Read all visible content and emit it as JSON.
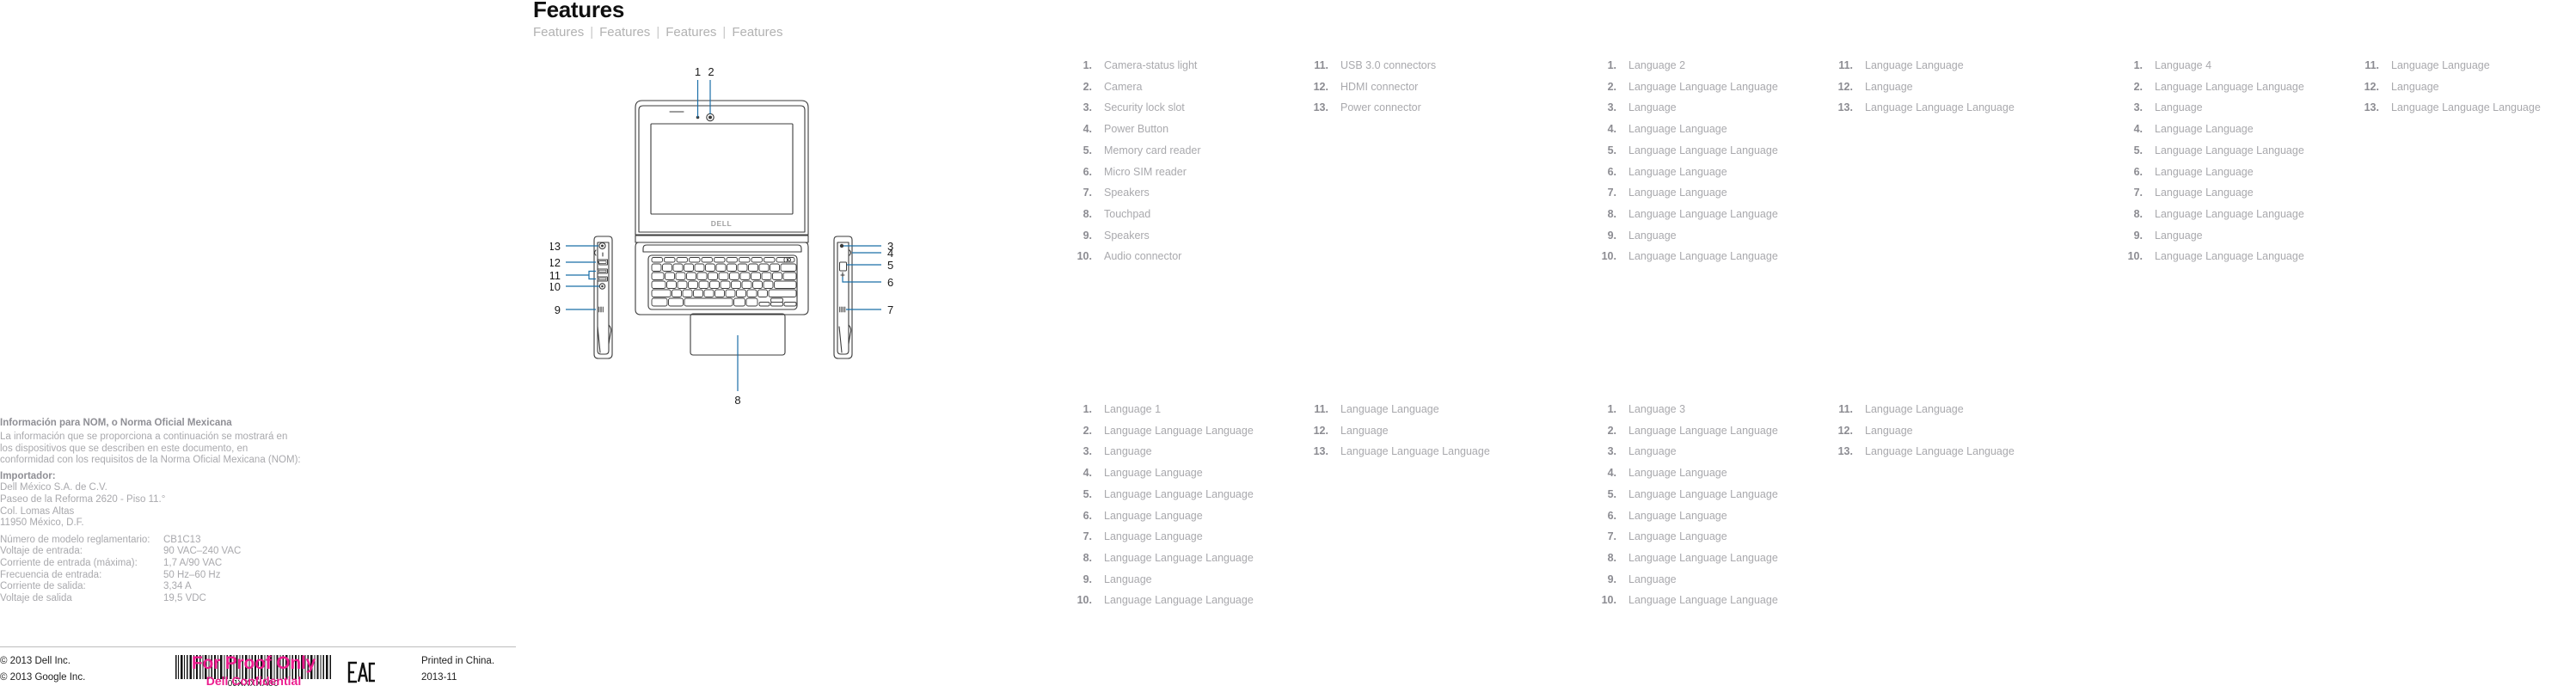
{
  "header": {
    "title": "Features",
    "subtitle_items": [
      "Features",
      "Features",
      "Features",
      "Features"
    ],
    "separator": "|"
  },
  "nom": {
    "heading": "Información para NOM, o Norma Oficial Mexicana",
    "intro": "La información que se proporciona a continuación se mostrará en los dispositivos que se describen en este documento, en conformidad con los requisitos de la Norma Oficial Mexicana (NOM):",
    "importer_label": "Importador:",
    "address": [
      "Dell México S.A. de C.V.",
      "Paseo de la Reforma 2620 - Piso 11.°",
      "Col. Lomas Altas",
      "11950 México, D.F."
    ],
    "specs": [
      {
        "label": "Número de modelo reglamentario:",
        "value": "CB1C13"
      },
      {
        "label": "Voltaje de entrada:",
        "value": "90 VAC–240 VAC"
      },
      {
        "label": "Corriente de entrada (máxima):",
        "value": "1,7 A/90 VAC"
      },
      {
        "label": "Frecuencia de entrada:",
        "value": "50 Hz–60 Hz"
      },
      {
        "label": "Corriente de salida:",
        "value": "3,34 A"
      },
      {
        "label": "Voltaje de salida",
        "value": "19,5 VDC"
      }
    ]
  },
  "footer": {
    "copyright_lines": [
      "© 2013 Dell Inc.",
      "© 2013 Google Inc."
    ],
    "barcode_number": "0JXXXXA00",
    "proof_line1": "For Proof Only",
    "proof_line2": "Dell Confidential",
    "eac_label": "EAC",
    "print_lines": [
      "Printed in China.",
      "2013-11"
    ]
  },
  "diagram": {
    "brand_logo": "DELL",
    "callouts": [
      {
        "id": "1",
        "label": "1"
      },
      {
        "id": "2",
        "label": "2"
      },
      {
        "id": "3",
        "label": "3"
      },
      {
        "id": "4",
        "label": "4"
      },
      {
        "id": "5",
        "label": "5"
      },
      {
        "id": "6",
        "label": "6"
      },
      {
        "id": "7",
        "label": "7"
      },
      {
        "id": "8",
        "label": "8"
      },
      {
        "id": "9",
        "label": "9"
      },
      {
        "id": "10",
        "label": "10"
      },
      {
        "id": "11",
        "label": "11"
      },
      {
        "id": "12",
        "label": "12"
      },
      {
        "id": "13",
        "label": "13"
      }
    ]
  },
  "feature_blocks": [
    {
      "id": "english-top",
      "col_a": [
        {
          "num": "1.",
          "text": "Camera-status light"
        },
        {
          "num": "2.",
          "text": "Camera"
        },
        {
          "num": "3.",
          "text": "Security lock slot"
        },
        {
          "num": "4.",
          "text": "Power Button"
        },
        {
          "num": "5.",
          "text": "Memory card reader"
        },
        {
          "num": "6.",
          "text": "Micro SIM reader"
        },
        {
          "num": "7.",
          "text": "Speakers"
        },
        {
          "num": "8.",
          "text": "Touchpad"
        },
        {
          "num": "9.",
          "text": "Speakers"
        },
        {
          "num": "10.",
          "text": "Audio connector"
        }
      ],
      "col_b": [
        {
          "num": "11.",
          "text": "USB 3.0 connectors"
        },
        {
          "num": "12.",
          "text": "HDMI connector"
        },
        {
          "num": "13.",
          "text": "Power connector"
        }
      ]
    },
    {
      "id": "language-2-top",
      "col_a": [
        {
          "num": "1.",
          "text": "Language 2"
        },
        {
          "num": "2.",
          "text": "Language Language Language"
        },
        {
          "num": "3.",
          "text": "Language"
        },
        {
          "num": "4.",
          "text": "Language Language"
        },
        {
          "num": "5.",
          "text": "Language Language Language"
        },
        {
          "num": "6.",
          "text": "Language Language"
        },
        {
          "num": "7.",
          "text": "Language Language"
        },
        {
          "num": "8.",
          "text": "Language Language Language"
        },
        {
          "num": "9.",
          "text": "Language"
        },
        {
          "num": "10.",
          "text": "Language Language Language"
        }
      ],
      "col_b": [
        {
          "num": "11.",
          "text": "Language Language"
        },
        {
          "num": "12.",
          "text": "Language"
        },
        {
          "num": "13.",
          "text": "Language Language Language"
        }
      ]
    },
    {
      "id": "language-4-top",
      "col_a": [
        {
          "num": "1.",
          "text": "Language 4"
        },
        {
          "num": "2.",
          "text": "Language Language Language"
        },
        {
          "num": "3.",
          "text": "Language"
        },
        {
          "num": "4.",
          "text": "Language Language"
        },
        {
          "num": "5.",
          "text": "Language Language Language"
        },
        {
          "num": "6.",
          "text": "Language Language"
        },
        {
          "num": "7.",
          "text": "Language Language"
        },
        {
          "num": "8.",
          "text": "Language Language Language"
        },
        {
          "num": "9.",
          "text": "Language"
        },
        {
          "num": "10.",
          "text": "Language Language Language"
        }
      ],
      "col_b": [
        {
          "num": "11.",
          "text": "Language Language"
        },
        {
          "num": "12.",
          "text": "Language"
        },
        {
          "num": "13.",
          "text": "Language Language Language"
        }
      ]
    },
    {
      "id": "language-1-bottom",
      "col_a": [
        {
          "num": "1.",
          "text": "Language 1"
        },
        {
          "num": "2.",
          "text": "Language Language Language"
        },
        {
          "num": "3.",
          "text": "Language"
        },
        {
          "num": "4.",
          "text": "Language Language"
        },
        {
          "num": "5.",
          "text": "Language Language Language"
        },
        {
          "num": "6.",
          "text": "Language Language"
        },
        {
          "num": "7.",
          "text": "Language Language"
        },
        {
          "num": "8.",
          "text": "Language Language Language"
        },
        {
          "num": "9.",
          "text": "Language"
        },
        {
          "num": "10.",
          "text": "Language Language Language"
        }
      ],
      "col_b": [
        {
          "num": "11.",
          "text": "Language Language"
        },
        {
          "num": "12.",
          "text": "Language"
        },
        {
          "num": "13.",
          "text": "Language Language Language"
        }
      ]
    },
    {
      "id": "language-3-bottom",
      "col_a": [
        {
          "num": "1.",
          "text": "Language 3"
        },
        {
          "num": "2.",
          "text": "Language Language Language"
        },
        {
          "num": "3.",
          "text": "Language"
        },
        {
          "num": "4.",
          "text": "Language Language"
        },
        {
          "num": "5.",
          "text": "Language Language Language"
        },
        {
          "num": "6.",
          "text": "Language Language"
        },
        {
          "num": "7.",
          "text": "Language Language"
        },
        {
          "num": "8.",
          "text": "Language Language Language"
        },
        {
          "num": "9.",
          "text": "Language"
        },
        {
          "num": "10.",
          "text": "Language Language Language"
        }
      ],
      "col_b": [
        {
          "num": "11.",
          "text": "Language Language"
        },
        {
          "num": "12.",
          "text": "Language"
        },
        {
          "num": "13.",
          "text": "Language Language Language"
        }
      ]
    }
  ],
  "colors": {
    "text_gray": "#a9a9ad",
    "num_gray": "#8c8c92",
    "title_black": "#101010",
    "subtitle_gray": "#b2b2b2",
    "callout_blue": "#1a6fa8",
    "line_gray": "#3b3b3b",
    "proof_magenta": "#ec1c8e"
  }
}
